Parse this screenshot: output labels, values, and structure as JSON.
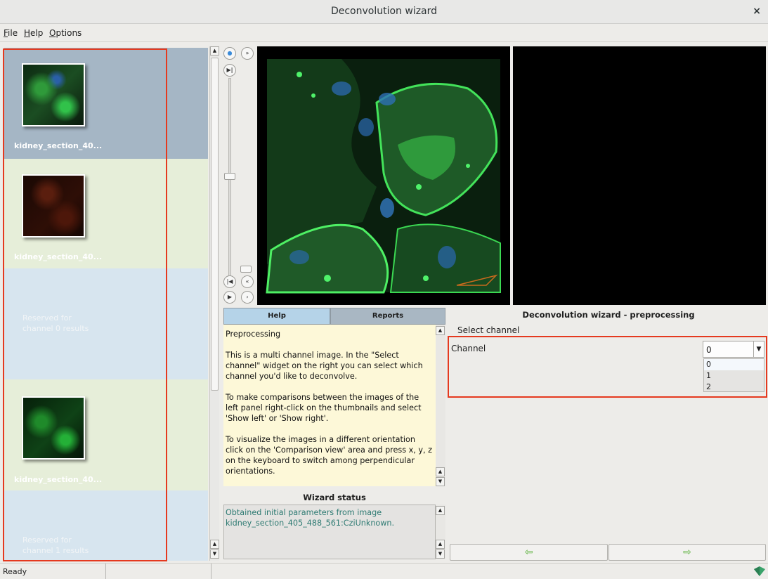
{
  "window": {
    "title": "Deconvolution wizard",
    "close_glyph": "×"
  },
  "menu": {
    "file": "File",
    "help": "Help",
    "options": "Options"
  },
  "thumbnails": [
    {
      "type": "image",
      "label": "kidney_section_40...",
      "bg": "#a5b6c5",
      "tint": "green-blue"
    },
    {
      "type": "image",
      "label": "kidney_section_40...",
      "bg": "#e6eed9",
      "tint": "red"
    },
    {
      "type": "reserved",
      "text_line1": "Reserved for",
      "text_line2": "channel 0 results",
      "bg": "#d7e5ef"
    },
    {
      "type": "image",
      "label": "kidney_section_40...",
      "bg": "#e6eed9",
      "tint": "green"
    },
    {
      "type": "reserved",
      "text_line1": "Reserved for",
      "text_line2": "channel 1 results",
      "bg": "#d7e5ef"
    }
  ],
  "tabs": {
    "help": "Help",
    "reports": "Reports"
  },
  "help_text": {
    "heading": "Preprocessing",
    "p1": "This is a multi channel image. In the \"Select channel\" widget on the right you can select which channel you'd like to deconvolve.",
    "p2": "To make comparisons between the images of the left panel right-click on the thumbnails  and select 'Show left' or 'Show right'.",
    "p3": "To visualize the images in a different orientation click on the 'Comparison view' area and press x, y, z on the keyboard to switch among perpendicular orientations."
  },
  "wizard_status": {
    "title": "Wizard status",
    "line1": "Obtained initial parameters from image",
    "line2": "kidney_section_405_488_561:CziUnknown."
  },
  "right_panel": {
    "title": "Deconvolution wizard - preprocessing",
    "select_label": "Select channel",
    "channel_label": "Channel",
    "selected_value": "0",
    "options": [
      "0",
      "1",
      "2"
    ]
  },
  "nav": {
    "back": "⇦",
    "next": "⇨"
  },
  "statusbar": {
    "text": "Ready"
  },
  "colors": {
    "accent": "#e5391f",
    "status_text": "#2f7b73",
    "help_bg": "#fdf8d8",
    "nav_arrow": "#5fb340"
  }
}
